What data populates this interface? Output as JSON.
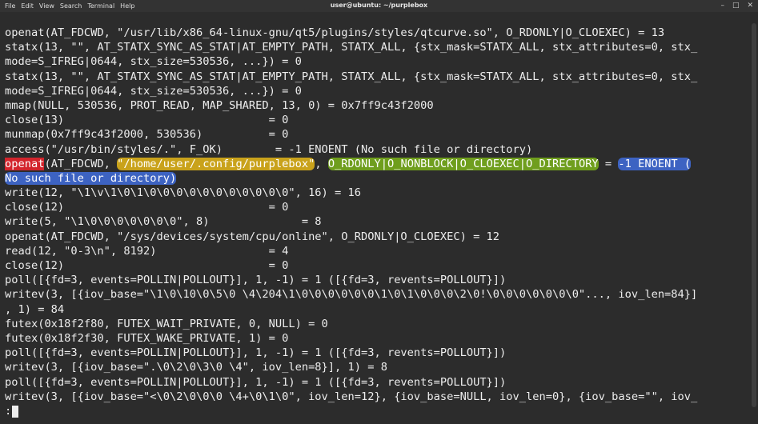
{
  "window": {
    "title": "user@ubuntu: ~/purplebox",
    "menu": [
      "File",
      "Edit",
      "View",
      "Search",
      "Terminal",
      "Help"
    ],
    "controls": {
      "minimize": "–",
      "maximize": "□",
      "close": "✕"
    }
  },
  "terminal": {
    "lines": [
      "openat(AT_FDCWD, \"/usr/lib/x86_64-linux-gnu/qt5/plugins/styles/qtcurve.so\", O_RDONLY|O_CLOEXEC) = 13",
      "statx(13, \"\", AT_STATX_SYNC_AS_STAT|AT_EMPTY_PATH, STATX_ALL, {stx_mask=STATX_ALL, stx_attributes=0, stx_",
      "mode=S_IFREG|0644, stx_size=530536, ...}) = 0",
      "statx(13, \"\", AT_STATX_SYNC_AS_STAT|AT_EMPTY_PATH, STATX_ALL, {stx_mask=STATX_ALL, stx_attributes=0, stx_",
      "mode=S_IFREG|0644, stx_size=530536, ...}) = 0",
      "mmap(NULL, 530536, PROT_READ, MAP_SHARED, 13, 0) = 0x7ff9c43f2000",
      "close(13)                               = 0",
      "munmap(0x7ff9c43f2000, 530536)          = 0",
      "access(\"/usr/bin/styles/.\", F_OK)        = -1 ENOENT (No such file or directory)",
      "__HIGHLIGHT__",
      "__HIGHLIGHT_CONT__",
      "write(12, \"\\1\\v\\1\\0\\1\\0\\0\\0\\0\\0\\0\\0\\0\\0\\0\\0\", 16) = 16",
      "close(12)                               = 0",
      "write(5, \"\\1\\0\\0\\0\\0\\0\\0\\0\", 8)              = 8",
      "openat(AT_FDCWD, \"/sys/devices/system/cpu/online\", O_RDONLY|O_CLOEXEC) = 12",
      "read(12, \"0-3\\n\", 8192)                 = 4",
      "close(12)                               = 0",
      "poll([{fd=3, events=POLLIN|POLLOUT}], 1, -1) = 1 ([{fd=3, revents=POLLOUT}])",
      "writev(3, [{iov_base=\"\\1\\0\\10\\0\\5\\0 \\4\\204\\1\\0\\0\\0\\0\\0\\0\\1\\0\\1\\0\\0\\0\\2\\0!\\0\\0\\0\\0\\0\\0\\0\"..., iov_len=84}]",
      ", 1) = 84",
      "futex(0x18f2f80, FUTEX_WAIT_PRIVATE, 0, NULL) = 0",
      "futex(0x18f2f30, FUTEX_WAKE_PRIVATE, 1) = 0",
      "poll([{fd=3, events=POLLIN|POLLOUT}], 1, -1) = 1 ([{fd=3, revents=POLLOUT}])",
      "writev(3, [{iov_base=\".\\0\\2\\0\\3\\0 \\4\", iov_len=8}], 1) = 8",
      "poll([{fd=3, events=POLLIN|POLLOUT}], 1, -1) = 1 ([{fd=3, revents=POLLOUT}])",
      "writev(3, [{iov_base=\"<\\0\\2\\0\\0\\0 \\4+\\0\\1\\0\", iov_len=12}, {iov_base=NULL, iov_len=0}, {iov_base=\"\", iov_"
    ],
    "highlight": {
      "func": "openat",
      "arg1": "(AT_FDCWD, ",
      "path": "\"/home/user/.config/purplebox\"",
      "sep1": ", ",
      "flags": "O_RDONLY|O_NONBLOCK|O_CLOEXEC|O_DIRECTORY",
      "sep2": " = ",
      "result_1": "-1 ENOENT (",
      "result_2": "No such file or directory)"
    },
    "prompt": ":"
  },
  "colors": {
    "background": "#2c2c2c",
    "text": "#ededed",
    "highlight_function": "#d3242c",
    "highlight_path": "#c9a21b",
    "highlight_flags": "#6f9e1d",
    "highlight_result": "#3d63c2"
  }
}
